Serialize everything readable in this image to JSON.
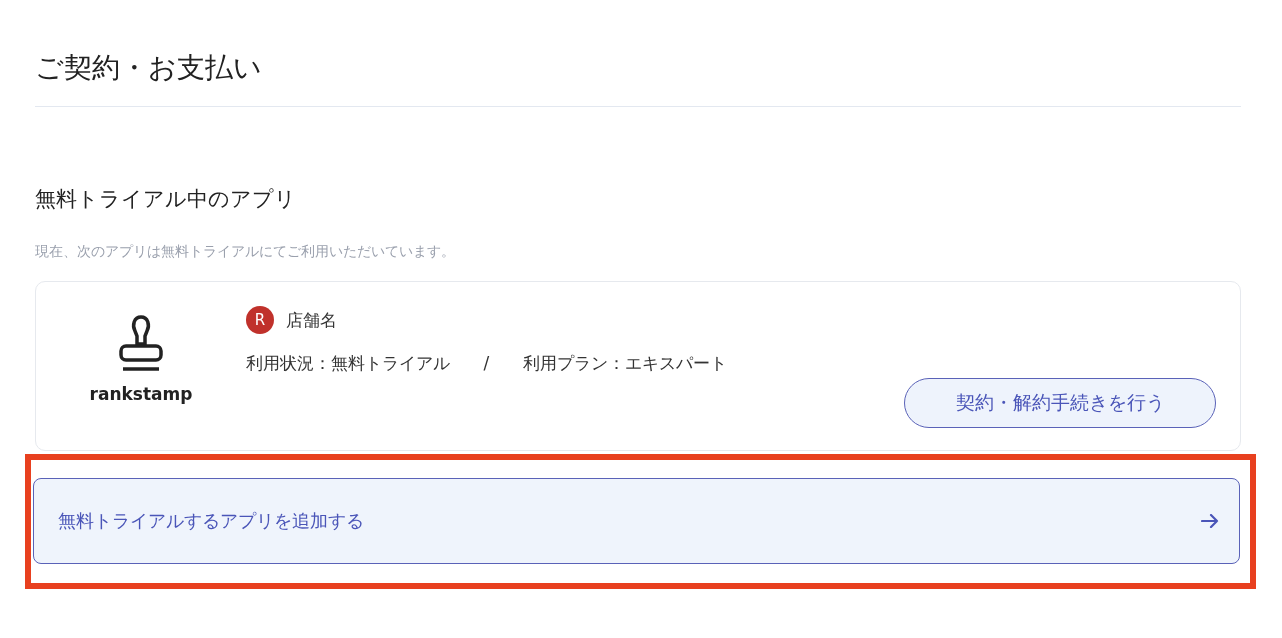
{
  "page_title": "ご契約・お支払い",
  "section": {
    "heading": "無料トライアル中のアプリ",
    "description": "現在、次のアプリは無料トライアルにてご利用いただいています。"
  },
  "apps": [
    {
      "logo_text": "rankstamp",
      "store_badge": "R",
      "store_name": "店舗名",
      "status": "利用状況：無料トライアル",
      "separator": "/",
      "plan": "利用プラン：エキスパート",
      "action": "契約・解約手続きを行う"
    }
  ],
  "add_button": {
    "label": "無料トライアルするアプリを追加する",
    "highlighted": true
  }
}
